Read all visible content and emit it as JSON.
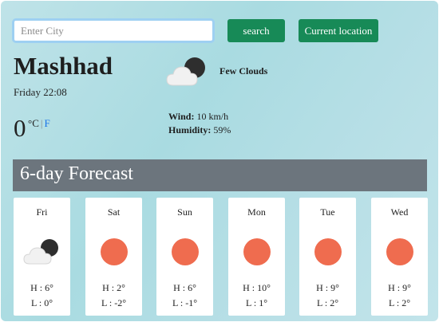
{
  "search": {
    "placeholder": "Enter City",
    "value": "",
    "search_label": "search",
    "location_label": "Current location"
  },
  "current": {
    "city": "Mashhad",
    "datetime": "Friday 22:08",
    "temperature": "0",
    "unit_c": "°C",
    "unit_sep": "|",
    "unit_f": "F",
    "description": "Few Clouds",
    "icon": "cloud-moon-icon",
    "wind_label": "Wind:",
    "wind_value": "10 km/h",
    "humidity_label": "Humidity:",
    "humidity_value": "59%"
  },
  "forecast": {
    "title": "6-day Forecast",
    "days": [
      {
        "day": "Fri",
        "icon": "cloud-moon-icon",
        "high": "H : 6°",
        "low": "L : 0°"
      },
      {
        "day": "Sat",
        "icon": "sun-icon",
        "high": "H : 2°",
        "low": "L : -2°"
      },
      {
        "day": "Sun",
        "icon": "sun-icon",
        "high": "H : 6°",
        "low": "L : -1°"
      },
      {
        "day": "Mon",
        "icon": "sun-icon",
        "high": "H : 10°",
        "low": "L : 1°"
      },
      {
        "day": "Tue",
        "icon": "sun-icon",
        "high": "H : 9°",
        "low": "L : 2°"
      },
      {
        "day": "Wed",
        "icon": "sun-icon",
        "high": "H : 9°",
        "low": "L : 2°"
      }
    ]
  },
  "colors": {
    "button": "#178a57",
    "sun": "#ef6c4f",
    "forecast_bar": "#6c757d",
    "link": "#1a73e8"
  }
}
